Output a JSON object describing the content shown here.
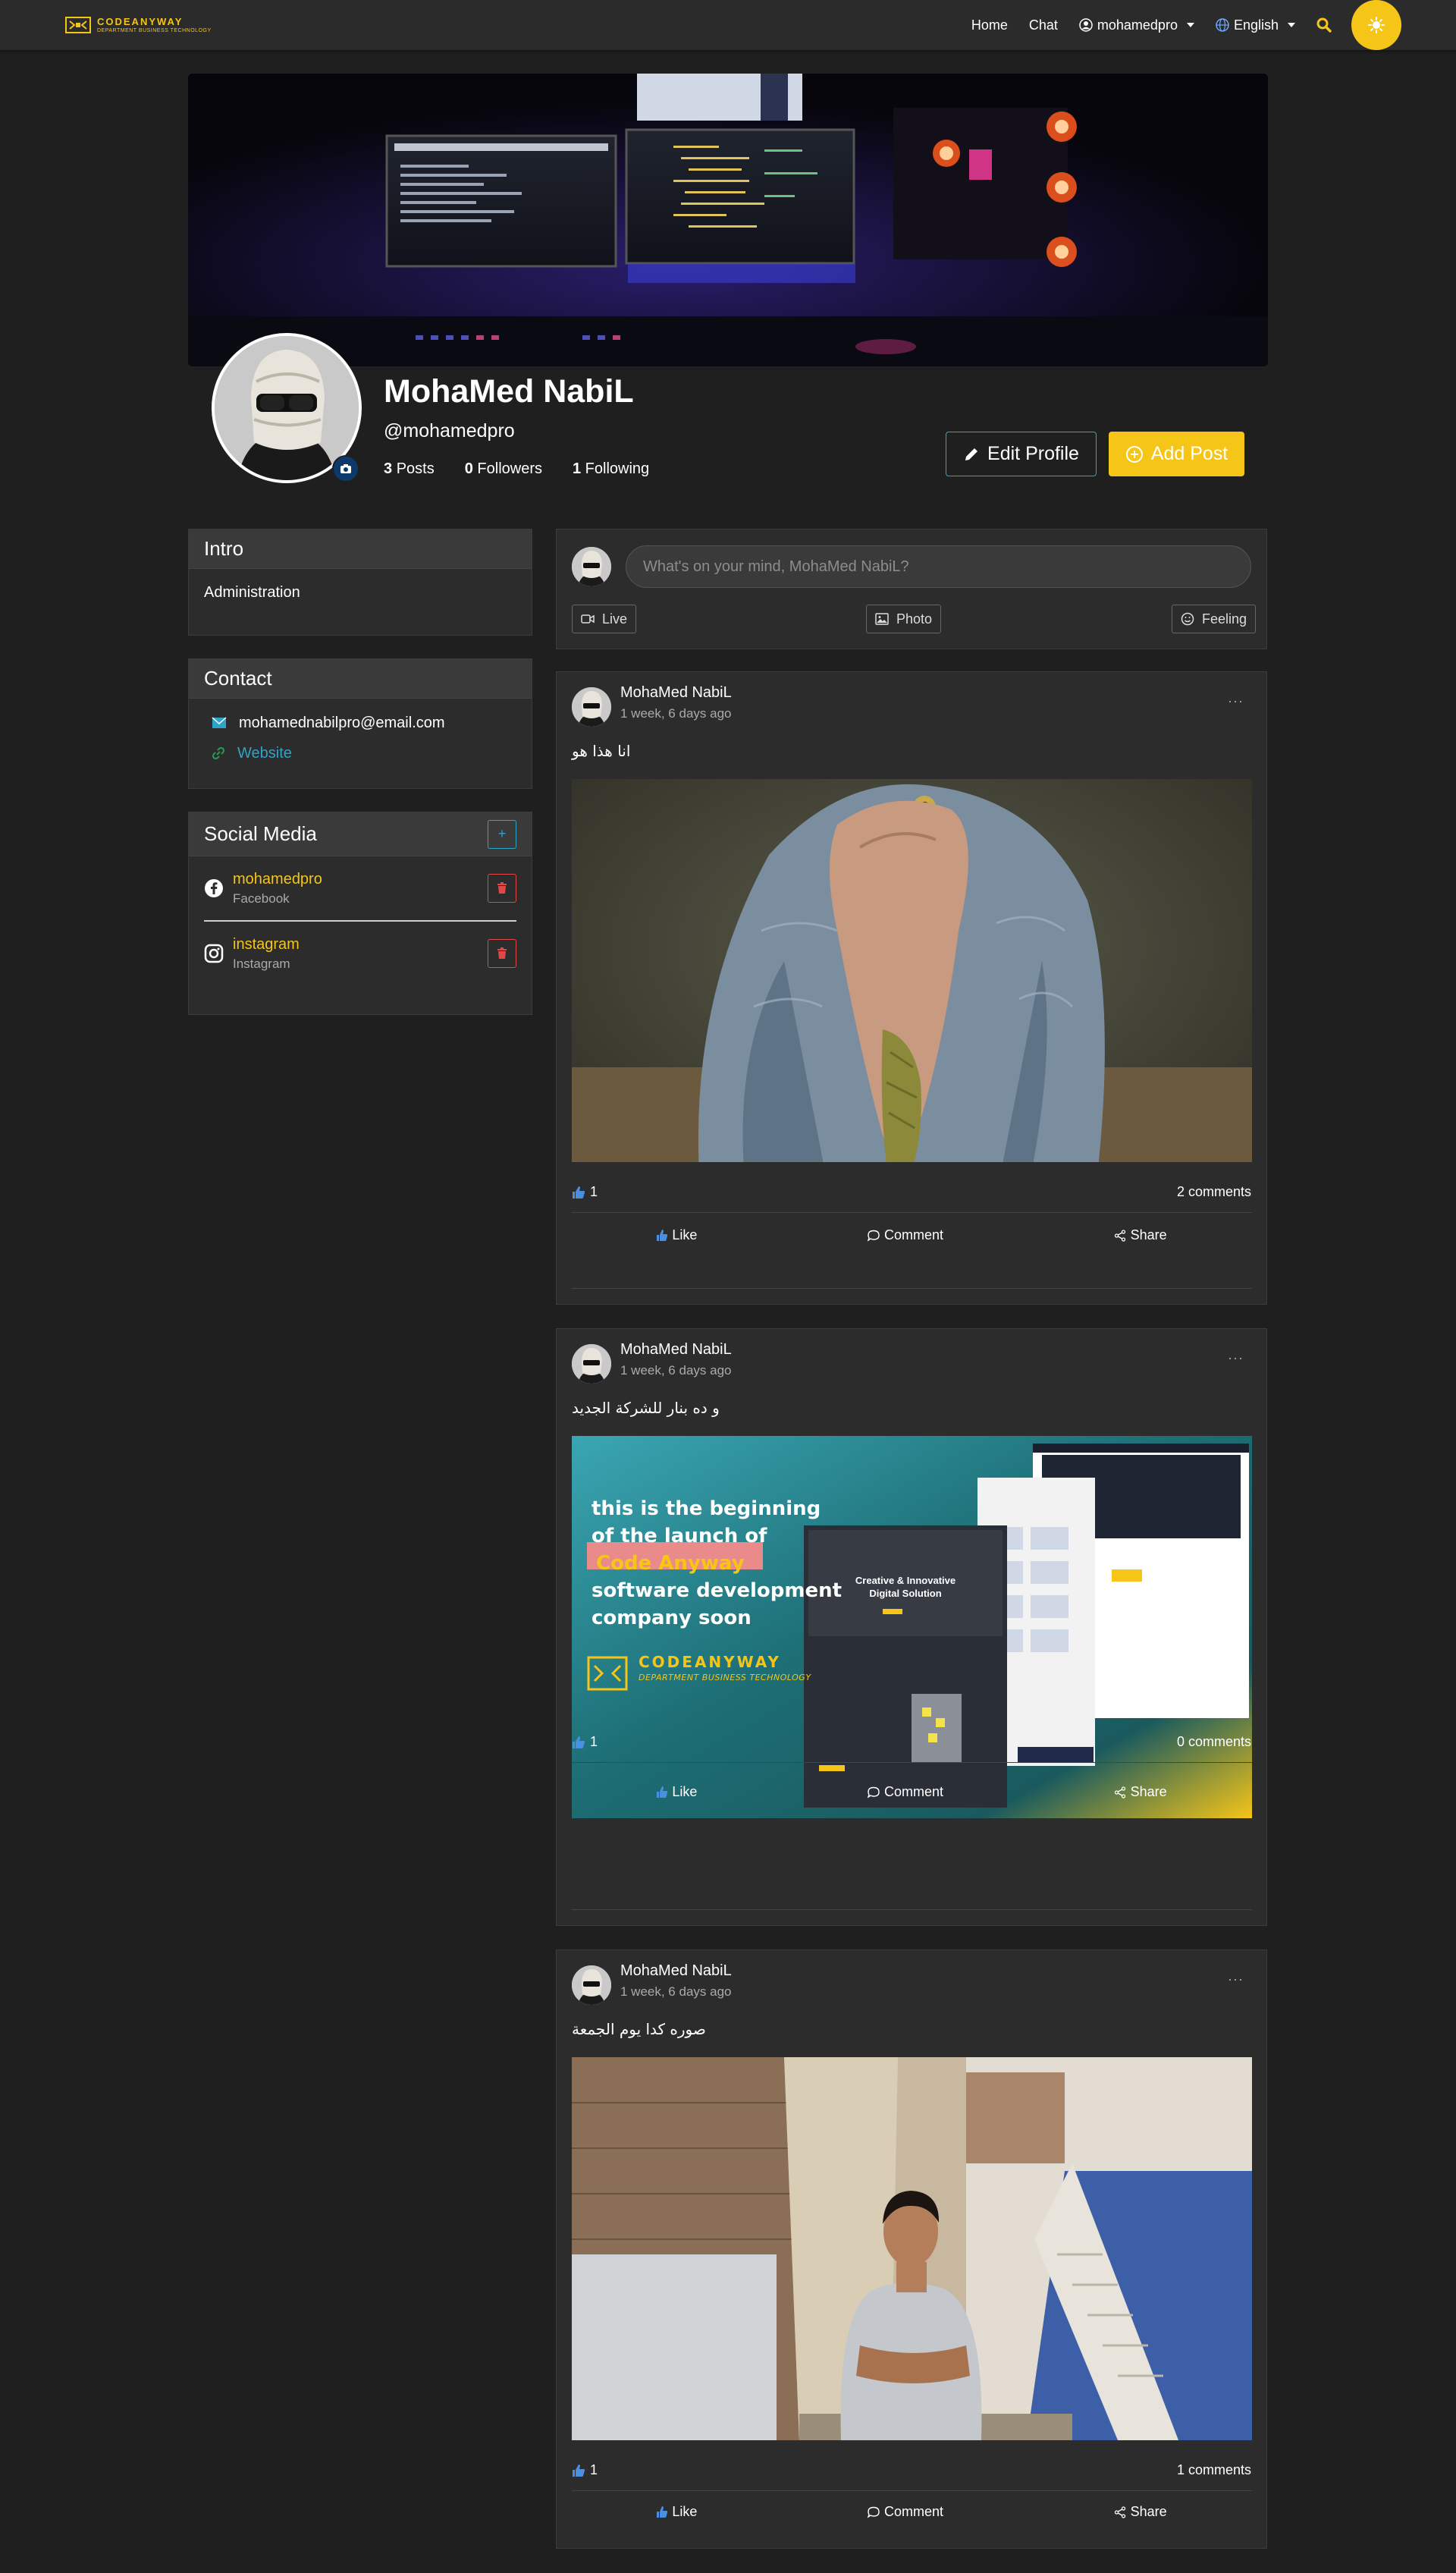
{
  "nav": {
    "logo_name": "CODEANYWAY",
    "logo_sub": "DEPARTMENT BUSINESS TECHNOLOGY",
    "home": "Home",
    "chat": "Chat",
    "user": "mohamedpro",
    "language": "English"
  },
  "profile": {
    "name": "MohaMed NabiL",
    "handle": "@mohamedpro",
    "posts_count": "3",
    "posts_label": "Posts",
    "followers_count": "0",
    "followers_label": "Followers",
    "following_count": "1",
    "following_label": "Following",
    "edit_label": "Edit Profile",
    "add_label": "Add Post"
  },
  "intro": {
    "title": "Intro",
    "text": "Administration"
  },
  "contact": {
    "title": "Contact",
    "email": "mohamednabilpro@email.com",
    "website": "Website"
  },
  "social": {
    "title": "Social Media",
    "add": "+",
    "items": [
      {
        "name": "mohamedpro",
        "type": "Facebook"
      },
      {
        "name": "instagram",
        "type": "Instagram"
      }
    ]
  },
  "composer": {
    "placeholder": "What's on your mind, MohaMed NabiL?",
    "live": "Live",
    "photo": "Photo",
    "feeling": "Feeling"
  },
  "posts": [
    {
      "author": "MohaMed NabiL",
      "time": "1 week, 6 days ago",
      "text": "انا هذا هو",
      "likes": "1",
      "comments": "2 comments"
    },
    {
      "author": "MohaMed NabiL",
      "time": "1 week, 6 days ago",
      "text": "و ده بنار للشركة الجديد",
      "likes": "1",
      "comments": "0 comments",
      "banner": {
        "l1": "this is the beginning",
        "l2": "of the launch of",
        "l3": "Code Anyway",
        "l4": "software development",
        "l5": "company soon",
        "brand": "CODEANYWAY",
        "brand_sub": "DEPARTMENT BUSINESS TECHNOLOGY",
        "mock_title": "Creative & Innovative Digital Solution"
      }
    },
    {
      "author": "MohaMed NabiL",
      "time": "1 week, 6 days ago",
      "text": "صوره كدا يوم الجمعة",
      "likes": "1",
      "comments": "1 comments"
    }
  ],
  "actions": {
    "like": "Like",
    "comment": "Comment",
    "share": "Share",
    "menu": "···"
  },
  "colors": {
    "accent": "#f5c518",
    "info": "#2fa4c9",
    "danger": "#e04848",
    "bg": "#1f1f1f",
    "card": "#2c2c2c"
  }
}
